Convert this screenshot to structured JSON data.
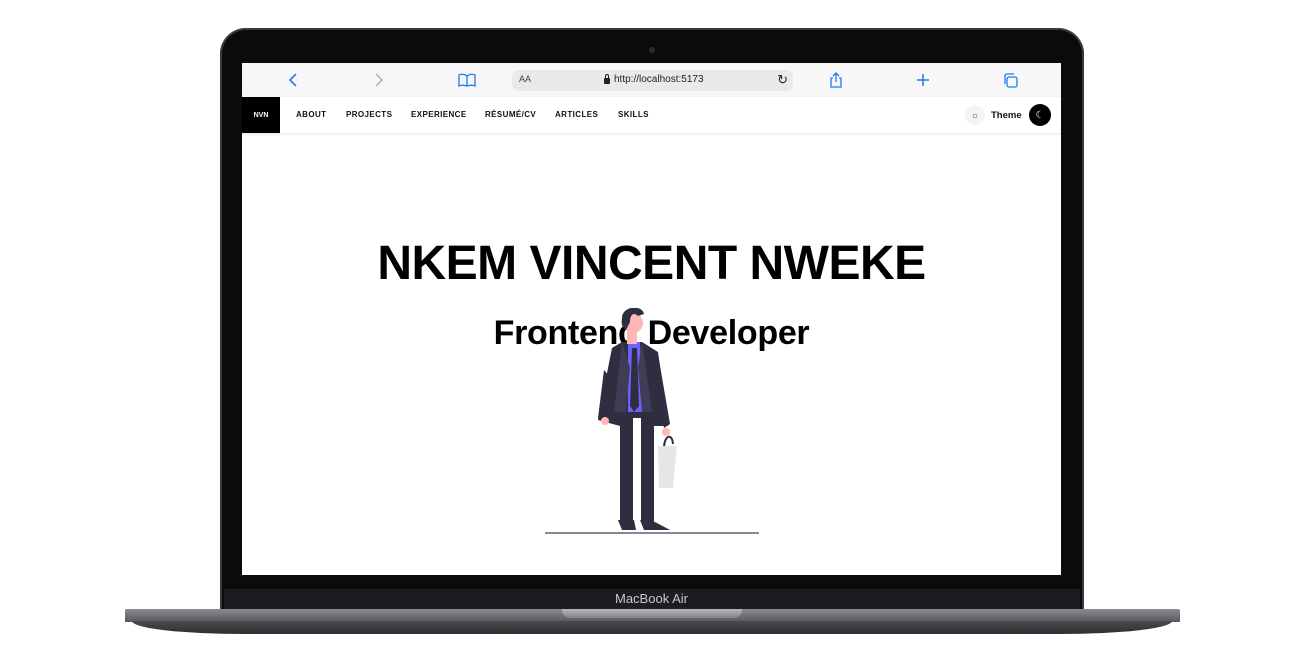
{
  "device": {
    "brand_label": "MacBook Air"
  },
  "browser": {
    "text_size_label": "AA",
    "url": "http://localhost:5173",
    "icons": [
      "chevron-left-icon",
      "chevron-right-icon",
      "book-icon",
      "lock-icon",
      "reload-icon",
      "share-icon",
      "plus-icon",
      "tabs-icon"
    ]
  },
  "site": {
    "logo": "NVN",
    "nav": [
      "ABOUT",
      "PROJECTS",
      "EXPERIENCE",
      "RÉSUMÉ/CV",
      "ARTICLES",
      "SKILLS"
    ],
    "theme_label": "Theme",
    "hero": {
      "name": "NKEM VINCENT NWEKE",
      "role": "Frontend Developer"
    }
  },
  "colors": {
    "accent": "#1a7cf5",
    "tie": "#6c63ff",
    "suit": "#2f2e41"
  }
}
